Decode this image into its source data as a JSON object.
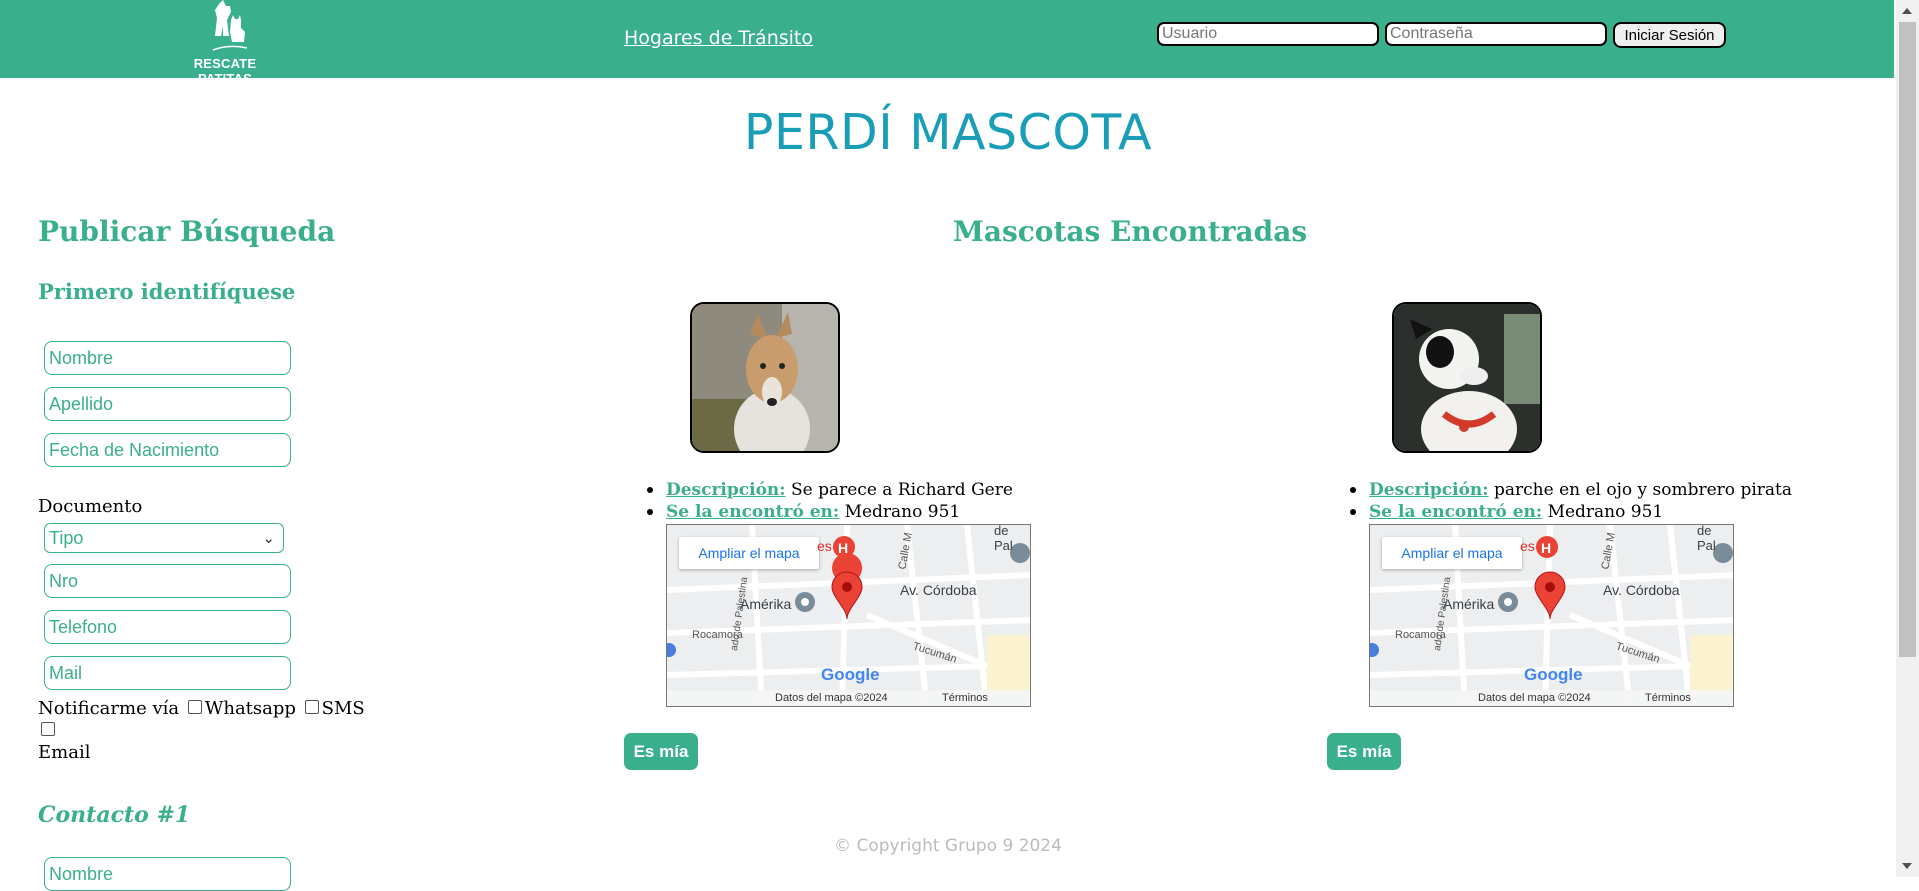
{
  "header": {
    "logo_text": "RESCATE PATITAS",
    "nav_link": "Hogares de Tránsito",
    "username_placeholder": "Usuario",
    "password_placeholder": "Contraseña",
    "login_button": "Iniciar Sesión"
  },
  "page_title": "PERDÍ MASCOTA",
  "form": {
    "heading": "Publicar Búsqueda",
    "subheading": "Primero identifíquese",
    "fields": {
      "nombre": "Nombre",
      "apellido": "Apellido",
      "fecha_nacimiento": "Fecha de Nacimiento",
      "nro": "Nro",
      "telefono": "Telefono",
      "mail": "Mail"
    },
    "documento_label": "Documento",
    "tipo_select": "Tipo",
    "notify_label": "Notificarme vía",
    "notify_options": [
      "Whatsapp",
      "SMS",
      "Email"
    ],
    "contact_heading": "Contacto #1",
    "contact_nombre": "Nombre"
  },
  "found": {
    "heading": "Mascotas Encontradas",
    "pets": [
      {
        "desc_label": "Descripción:",
        "desc": "Se parece a Richard Gere",
        "found_label": "Se la encontró en:",
        "found_at": "Medrano 951",
        "button": "Es mía"
      },
      {
        "desc_label": "Descripción:",
        "desc": "parche en el ojo y sombrero pirata",
        "found_label": "Se la encontró en:",
        "found_at": "Medrano 951",
        "button": "Es mía"
      }
    ],
    "map": {
      "enlarge": "Ampliar el mapa",
      "place_amerika": "Amérika",
      "street_cordoba": "Av. Córdoba",
      "street_tucuman": "Tucumán",
      "street_rocamora": "Rocamora",
      "street_calle": "Calle M",
      "street_palestina": "ado de Palestina",
      "label_es": "es",
      "label_pal": "de Pal",
      "brand": "Google",
      "data": "Datos del mapa ©2024",
      "terms": "Términos"
    }
  },
  "footer": "© Copyright Grupo 9 2024",
  "colors": {
    "brand_green": "#3aaf8c",
    "title_teal": "#1a9eb8",
    "marker_red": "#ea4335"
  }
}
